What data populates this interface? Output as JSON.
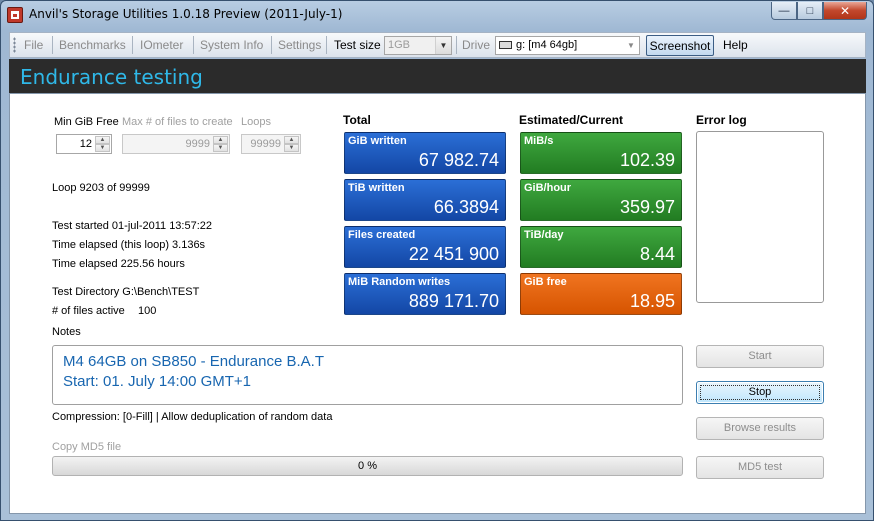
{
  "window": {
    "title": "Anvil's Storage Utilities 1.0.18 Preview (2011-July-1)",
    "minimize": "—",
    "maximize": "□",
    "close": "✕"
  },
  "menu": {
    "file": "File",
    "benchmarks": "Benchmarks",
    "iometer": "IOmeter",
    "system_info": "System Info",
    "settings": "Settings",
    "test_size_label": "Test size",
    "test_size_value": "1GB",
    "drive_label": "Drive",
    "drive_value": "g: [m4 64gb]",
    "screenshot": "Screenshot",
    "help": "Help"
  },
  "header": {
    "title": "Endurance testing"
  },
  "settings": {
    "min_free_label": "Min GiB Free",
    "min_free_value": "12",
    "max_files_label": "Max # of files to create",
    "max_files_value": "9999",
    "loops_label": "Loops",
    "loops_value": "99999"
  },
  "status": {
    "loop": "Loop 9203 of 99999",
    "started": "Test started 01-jul-2011 13:57:22",
    "elapsed_loop": "Time elapsed (this loop) 3.136s",
    "elapsed_total": "Time elapsed 225.56 hours",
    "test_dir": "Test Directory G:\\Bench\\TEST",
    "files_active_label": "# of files active",
    "files_active_value": "100"
  },
  "totals": {
    "heading": "Total",
    "tiles": [
      {
        "label": "GiB written",
        "value": "67 982.74"
      },
      {
        "label": "TiB written",
        "value": "66.3894"
      },
      {
        "label": "Files created",
        "value": "22 451 900"
      },
      {
        "label": "MiB Random writes",
        "value": "889 171.70"
      }
    ]
  },
  "estimates": {
    "heading": "Estimated/Current",
    "tiles": [
      {
        "label": "MiB/s",
        "value": "102.39"
      },
      {
        "label": "GiB/hour",
        "value": "359.97"
      },
      {
        "label": "TiB/day",
        "value": "8.44"
      },
      {
        "label": "GiB free",
        "value": "18.95"
      }
    ]
  },
  "error_log": {
    "heading": "Error log"
  },
  "notes": {
    "label": "Notes",
    "line1": "M4 64GB on SB850 - Endurance B.A.T",
    "line2": "Start: 01. July 14:00 GMT+1"
  },
  "compression": "Compression: [0-Fill] | Allow deduplication of random data",
  "md5": {
    "label": "Copy MD5 file",
    "progress_text": "0 %",
    "progress_fraction": 0
  },
  "buttons": {
    "start": "Start",
    "stop": "Stop",
    "browse": "Browse results",
    "md5_test": "MD5 test"
  },
  "colors": {
    "header_title": "#2fb8e8",
    "tile_blue": "#1a56bd",
    "tile_green": "#2e922e",
    "tile_orange": "#e8640e",
    "notes_text": "#1866b0"
  }
}
